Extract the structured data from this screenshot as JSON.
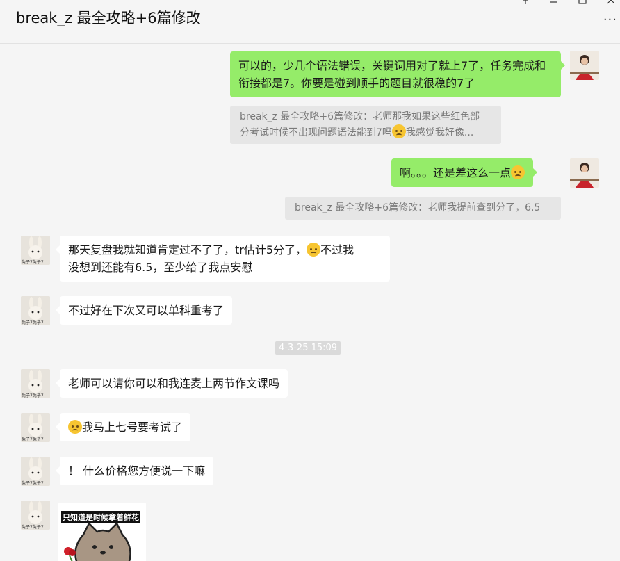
{
  "window": {
    "title": "break_z 最全攻略+6篇修改",
    "pin_icon": "pin-icon",
    "minimize_icon": "minimize-icon",
    "maximize_icon": "maximize-icon",
    "close_icon": "close-icon",
    "more_label": "···"
  },
  "messages": [
    {
      "id": "m1",
      "side": "me",
      "text": "可以的，少几个语法错误，关键词用对了就上7了，任务完成和衔接都是7。你要是碰到顺手的题目就很稳的7了"
    },
    {
      "id": "q1",
      "quote_line1": "break_z 最全攻略+6篇修改：老师那我如果这些红色部",
      "quote_line2_a": "分考试时候不出现问题语法能到7吗",
      "quote_line2_b": "我感觉我好像..."
    },
    {
      "id": "m2",
      "side": "me",
      "text": "啊。。。还是差这么一点"
    },
    {
      "id": "q2",
      "quote_text": "break_z 最全攻略+6篇修改：老师我提前查到分了，6.5"
    },
    {
      "id": "m3",
      "side": "other",
      "line1_a": "那天复盘我就知道肯定过不了了，tr估计5分了，",
      "line1_b": "不过我",
      "line2": "没想到还能有6.5，至少给了我点安慰"
    },
    {
      "id": "m4",
      "side": "other",
      "text": "不过好在下次又可以单科重考了"
    },
    {
      "id": "m5",
      "side": "other",
      "text": "老师可以请你可以和我连麦上两节作文课吗"
    },
    {
      "id": "m6",
      "side": "other",
      "text": "我马上七号要考试了"
    },
    {
      "id": "m7",
      "side": "other",
      "text": "！ 什么价格您方便说一下嘛"
    }
  ],
  "timestamp": "4-3-25 15:09",
  "avatar_caption": "兔子7兔子7",
  "sticker": {
    "caption": "只知道是时候拿着鲜花"
  },
  "colors": {
    "my_bubble": "#95ec69",
    "other_bubble": "#ffffff",
    "background": "#f5f5f5"
  }
}
